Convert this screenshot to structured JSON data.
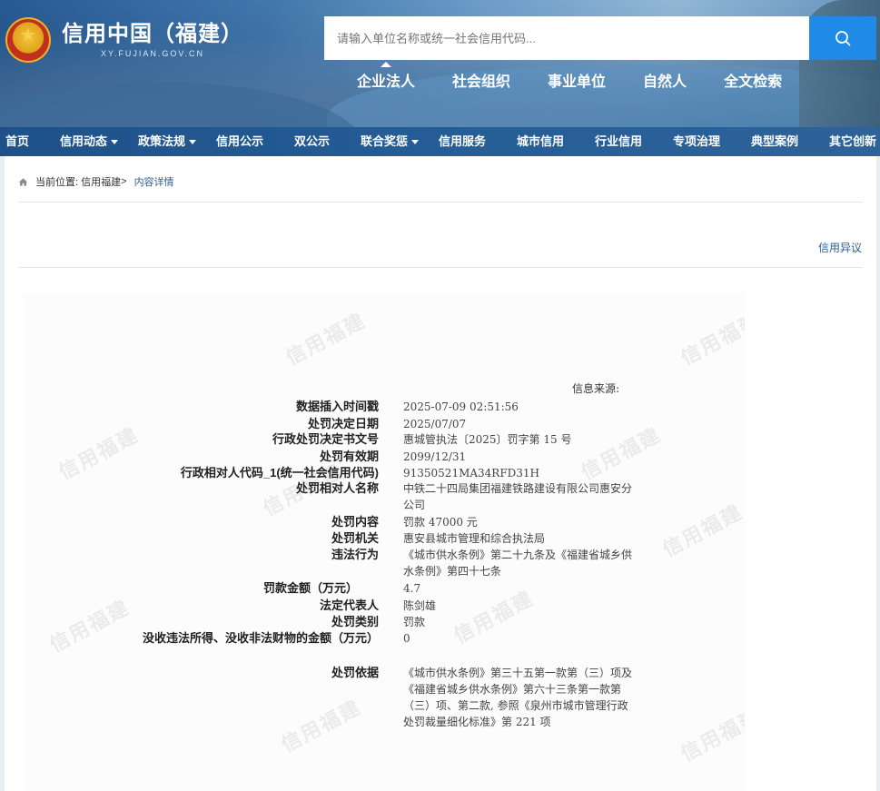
{
  "header": {
    "site_title": "信用中国（福建）",
    "site_domain": "XY.FUJIAN.GOV.CN",
    "search_placeholder": "请输入单位名称或统一社会信用代码..."
  },
  "category_tabs": [
    {
      "label": "企业法人",
      "active": true
    },
    {
      "label": "社会组织",
      "active": false
    },
    {
      "label": "事业单位",
      "active": false
    },
    {
      "label": "自然人",
      "active": false
    },
    {
      "label": "全文检索",
      "active": false
    }
  ],
  "nav": [
    {
      "label": "首页"
    },
    {
      "label": "信用动态",
      "dropdown": true
    },
    {
      "label": "政策法规",
      "dropdown": true
    },
    {
      "label": "信用公示"
    },
    {
      "label": "双公示"
    },
    {
      "label": "联合奖惩",
      "dropdown": true
    },
    {
      "label": "信用服务"
    },
    {
      "label": "城市信用"
    },
    {
      "label": "行业信用"
    },
    {
      "label": "专项治理"
    },
    {
      "label": "典型案例"
    },
    {
      "label": "其它创新"
    }
  ],
  "breadcrumb": {
    "prefix": "当前位置:",
    "home_link": "信用福建",
    "separator": ">",
    "current": "内容详情"
  },
  "objection_link": "信用异议",
  "document": {
    "watermark": "信用福建",
    "source_label": "信息来源:",
    "fields": [
      {
        "label": "数据插入时间戳",
        "value": "2025-07-09 02:51:56"
      },
      {
        "label": "处罚决定日期",
        "value": "2025/07/07"
      },
      {
        "label": "行政处罚决定书文号",
        "value": "惠城管执法〔2025〕罚字第 15 号"
      },
      {
        "label": "处罚有效期",
        "value": "2099/12/31"
      },
      {
        "label": "行政相对人代码_1(统一社会信用代码)",
        "value": "91350521MA34RFD31H"
      },
      {
        "label": "处罚相对人名称",
        "value": "中铁二十四局集团福建铁路建设有限公司惠安分公司"
      },
      {
        "label": "处罚内容",
        "value": "罚款 47000 元"
      },
      {
        "label": "处罚机关",
        "value": "惠安县城市管理和综合执法局"
      },
      {
        "label": "违法行为",
        "value": "《城市供水条例》第二十九条及《福建省城乡供水条例》第四十七条"
      },
      {
        "label": "罚款金额（万元）",
        "value": "4.7"
      },
      {
        "label": "法定代表人",
        "value": "陈剑雄"
      },
      {
        "label": "处罚类别",
        "value": "罚款"
      },
      {
        "label": "没收违法所得、没收非法财物的金额（万元）",
        "value": "0"
      },
      {
        "label": "处罚依据",
        "value": "《城市供水条例》第三十五第一款第（三）项及《福建省城乡供水条例》第六十三条第一款第（三）项、第二款, 参照《泉州市城市管理行政处罚裁量细化标准》第 221 项"
      }
    ]
  }
}
